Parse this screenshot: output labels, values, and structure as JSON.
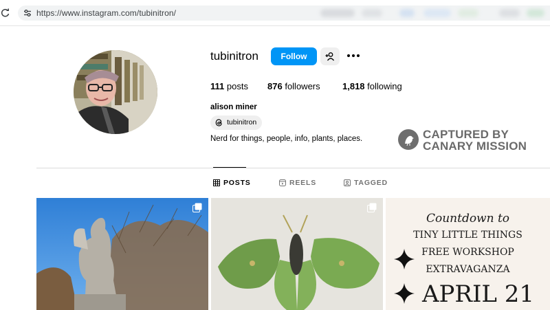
{
  "browser": {
    "url": "https://www.instagram.com/tubinitron/",
    "icons": [
      "reload-icon",
      "site-settings-icon"
    ]
  },
  "profile": {
    "username": "tubinitron",
    "follow_label": "Follow",
    "stats": {
      "posts_count": "111",
      "posts_label": "posts",
      "followers_count": "876",
      "followers_label": "followers",
      "following_count": "1,818",
      "following_label": "following"
    },
    "full_name": "alison miner",
    "threads_handle": "tubinitron",
    "bio": "Nerd for things, people, info, plants, places."
  },
  "watermark": {
    "line1": "CAPTURED BY",
    "line2": "CANARY MISSION"
  },
  "tabs": [
    {
      "label": "POSTS",
      "active": true,
      "icon": "grid-icon"
    },
    {
      "label": "REELS",
      "active": false,
      "icon": "reels-icon"
    },
    {
      "label": "TAGGED",
      "active": false,
      "icon": "tagged-icon"
    }
  ],
  "posts": [
    {
      "subject": "angel-statue-photo",
      "multi": true
    },
    {
      "subject": "luna-moth-photo",
      "multi": true
    },
    {
      "subject": "workshop-flyer",
      "multi": false,
      "lines": [
        "Countdown to",
        "TINY LITTLE THINGS",
        "FREE WORKSHOP",
        "EXTRAVAGANZA",
        "APRIL 21"
      ]
    }
  ],
  "colors": {
    "follow_button": "#0095f6",
    "watermark_gray": "#6a6a6a",
    "tab_inactive": "#737373"
  }
}
